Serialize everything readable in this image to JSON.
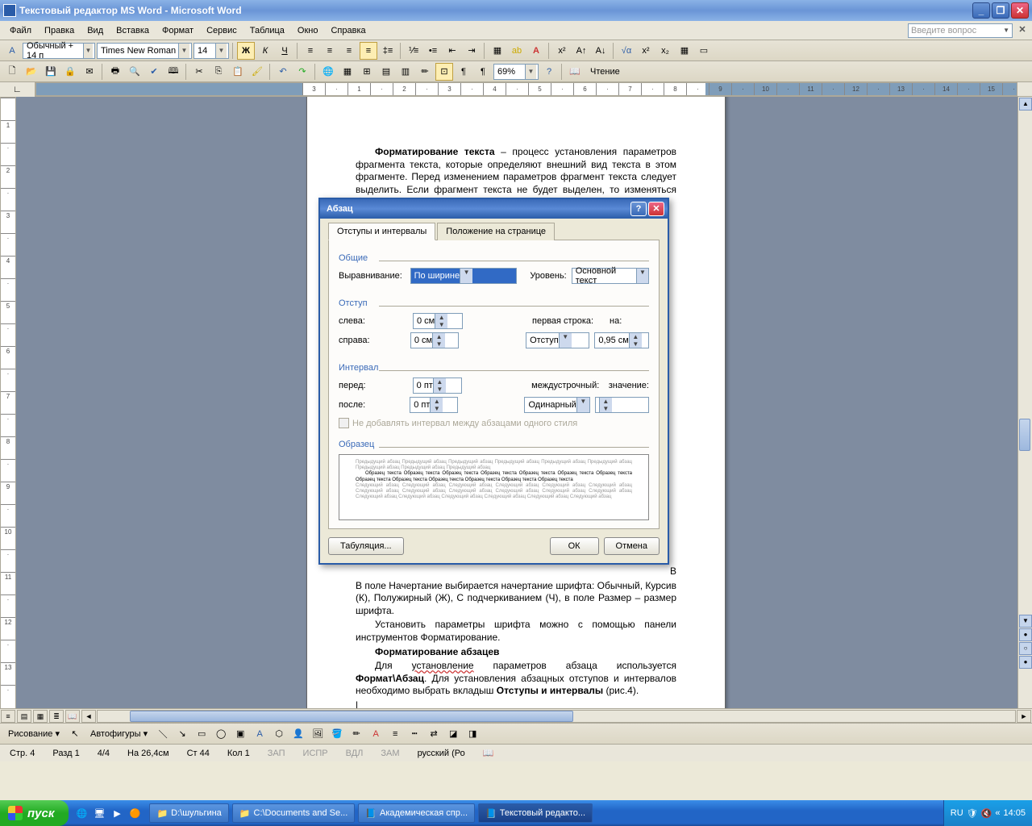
{
  "titlebar": {
    "title": "Текстовый редактор MS Word - Microsoft Word"
  },
  "menu": {
    "file": "Файл",
    "edit": "Правка",
    "view": "Вид",
    "insert": "Вставка",
    "format": "Формат",
    "tools": "Сервис",
    "table": "Таблица",
    "window": "Окно",
    "help": "Справка",
    "question": "Введите вопрос"
  },
  "fmt": {
    "style": "Обычный + 14 п",
    "font": "Times New Roman",
    "size": "14",
    "zoom": "69%",
    "reading": "Чтение"
  },
  "doc": {
    "p1a": "Форматирование текста",
    "p1b": " – процесс установления параметров фрагмента текста, которые определяют внешний вид текста в этом фрагменте. Перед изменением параметров фрагмент текста следует выделить. Если фрагмент текста не будет выделен, то изменяться будут текущие параметры.",
    "p2": "В поле Начертание выбирается начертание шрифта: Обычный, Курсив (К), Полужирный (Ж), С подчеркиванием (Ч), в поле Размер – размер шрифта.",
    "p3": "Установить параметры шрифта можно с помощью панели инструментов Форматирование.",
    "p4": "Форматирование абзацев",
    "p5a": "Для ",
    "p5s": "установление",
    "p5b": " параметров абзаца используется ",
    "p5c": "Формат\\Абзац",
    "p5d": ". Для установления абзацных отступов и интервалов необходимо выбрать вкладыш ",
    "p5e": "Отступы и интервалы",
    "p5f": " (рис.4)."
  },
  "dlg": {
    "title": "Абзац",
    "tab1": "Отступы и интервалы",
    "tab2": "Положение на странице",
    "g_general": "Общие",
    "l_align": "Выравнивание:",
    "v_align": "По ширине",
    "l_level": "Уровень:",
    "v_level": "Основной текст",
    "g_indent": "Отступ",
    "l_left": "слева:",
    "v_left": "0 см",
    "l_right": "справа:",
    "v_right": "0 см",
    "l_first": "первая строка:",
    "l_by": "на:",
    "v_first": "Отступ",
    "v_by": "0,95 см",
    "g_spacing": "Интервал",
    "l_before": "перед:",
    "v_before": "0 пт",
    "l_after": "после:",
    "v_after": "0 пт",
    "l_line": "междустрочный:",
    "l_at": "значение:",
    "v_line": "Одинарный",
    "v_at": "",
    "chk": "Не добавлять интервал между абзацами одного стиля",
    "g_preview": "Образец",
    "prev_gray": "Предыдущий абзац Предыдущий абзац Предыдущий абзац Предыдущий абзац Предыдущий абзац Предыдущий абзац Предыдущий абзац Предыдущий абзац Предыдущий абзац",
    "prev_dark": "Образец текста Образец текста Образец текста Образец текста Образец текста Образец текста Образец текста Образец текста Образец текста Образец текста Образец текста Образец текста Образец текста",
    "prev_gray2": "Следующий абзац Следующий абзац Следующий абзац Следующий абзац Следующий абзац Следующий абзац Следующий абзац Следующий абзац Следующий абзац Следующий абзац Следующий абзац Следующий абзац Следующий абзац Следующий абзац Следующий абзац Следующий абзац Следующий абзац Следующий абзац",
    "btn_tabs": "Табуляция...",
    "btn_ok": "ОК",
    "btn_cancel": "Отмена"
  },
  "draw": {
    "label": "Рисование",
    "autoshapes": "Автофигуры"
  },
  "status": {
    "page": "Стр. 4",
    "sec": "Разд 1",
    "pages": "4/4",
    "at": "На 26,4см",
    "ln": "Ст 44",
    "col": "Кол 1",
    "rec": "ЗАП",
    "trk": "ИСПР",
    "ext": "ВДЛ",
    "ovr": "ЗАМ",
    "lang": "русский (Ро"
  },
  "taskbar": {
    "start": "пуск",
    "t1": "D:\\шульгина",
    "t2": "C:\\Documents and Se...",
    "t3": "Академическая спр...",
    "t4": "Текстовый редакто...",
    "lang": "RU",
    "time": "14:05"
  }
}
